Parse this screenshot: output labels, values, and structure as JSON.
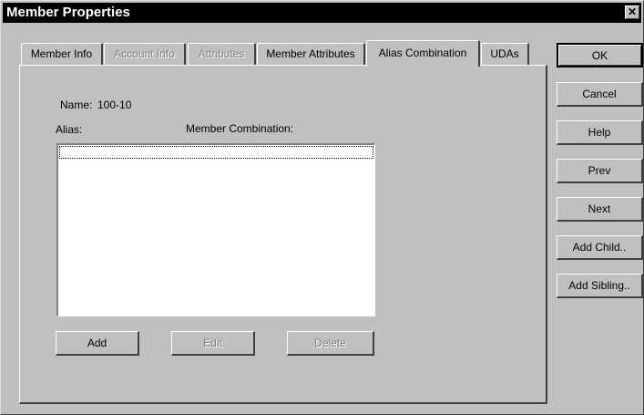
{
  "window": {
    "title": "Member Properties",
    "close_glyph": "✕"
  },
  "tabs": [
    {
      "label": "Member Info",
      "state": "normal"
    },
    {
      "label": "Account Info",
      "state": "disabled"
    },
    {
      "label": "Attributes",
      "state": "disabled"
    },
    {
      "label": "Member Attributes",
      "state": "normal"
    },
    {
      "label": "Alias Combination",
      "state": "active"
    },
    {
      "label": "UDAs",
      "state": "normal"
    }
  ],
  "panel": {
    "name_label": "Name:",
    "name_value": "100-10",
    "alias_label": "Alias:",
    "member_combination_label": "Member Combination:",
    "list_items": [
      ""
    ],
    "add_button": "Add",
    "edit_button": "Edit",
    "delete_button": "Delete"
  },
  "side_buttons": {
    "ok": "OK",
    "cancel": "Cancel",
    "help": "Help",
    "prev": "Prev",
    "next": "Next",
    "add_child": "Add Child..",
    "add_sibling": "Add Sibling.."
  }
}
